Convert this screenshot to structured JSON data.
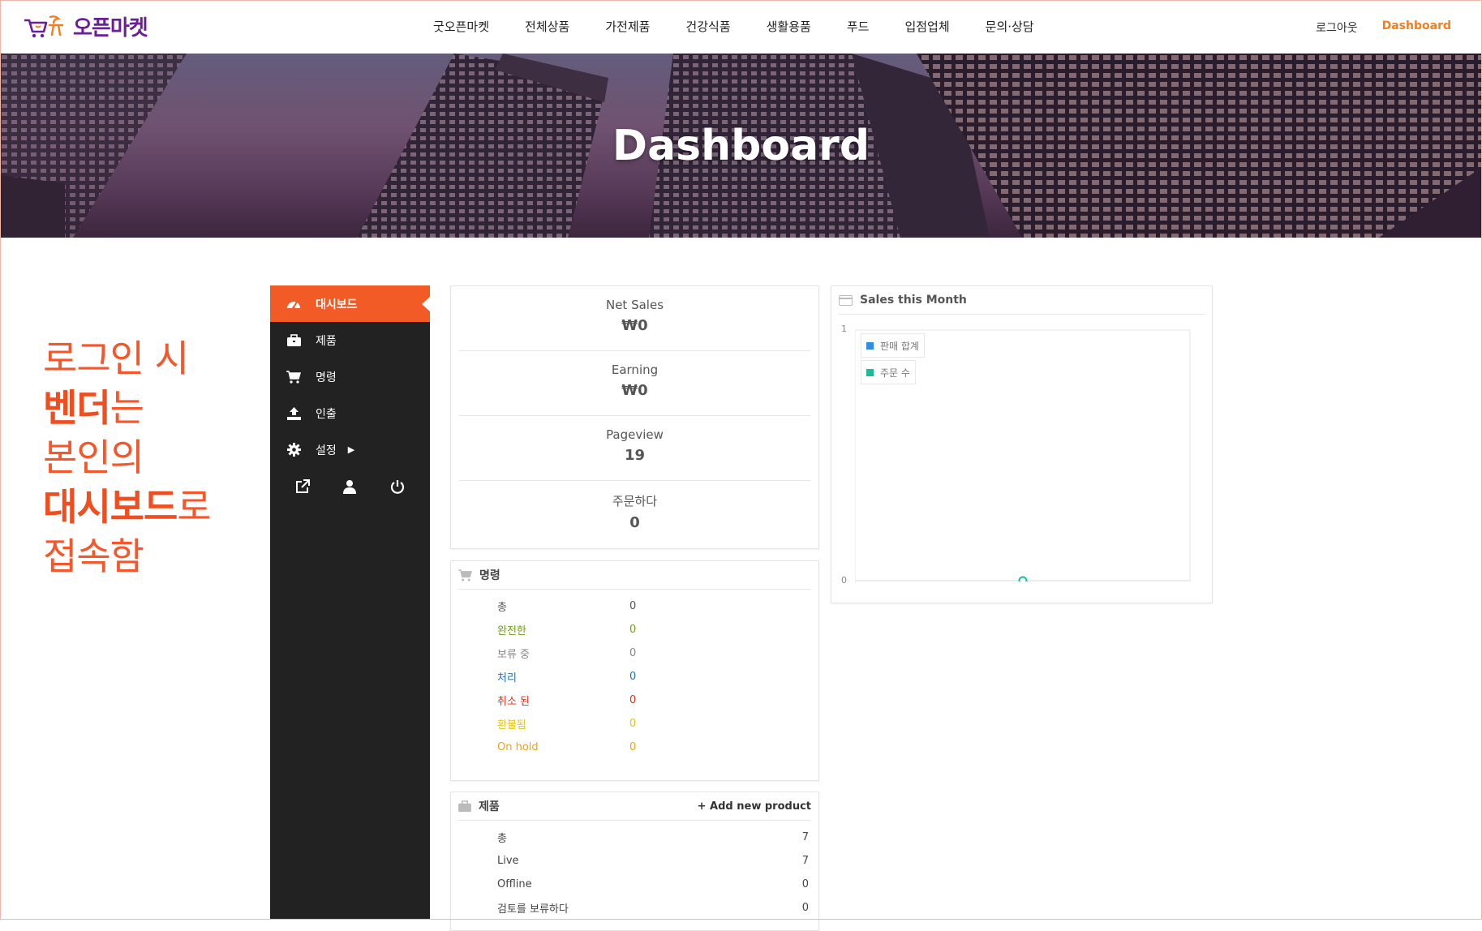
{
  "brand": {
    "name": "오픈마켓",
    "accent": "#f25a26",
    "logo_color": "#6a1f9a"
  },
  "nav": {
    "items": [
      "굿오픈마켓",
      "전체상품",
      "가전제품",
      "건강식품",
      "생활용품",
      "푸드",
      "입점업체",
      "문의·상담"
    ],
    "logout": "로그아웃",
    "dashboard": "Dashboard"
  },
  "hero": {
    "title": "Dashboard"
  },
  "tagline": {
    "line1": "로그인 시",
    "line2_bold": "벤더",
    "line2_rest": "는",
    "line3": "본인의",
    "line4_bold": "대시보드",
    "line4_rest": "로",
    "line5": "접속함"
  },
  "sidebar": {
    "items": [
      {
        "label": "대시보드",
        "icon": "dashboard-gauge-icon",
        "active": true
      },
      {
        "label": "제품",
        "icon": "briefcase-icon"
      },
      {
        "label": "명령",
        "icon": "cart-icon"
      },
      {
        "label": "인출",
        "icon": "upload-icon"
      },
      {
        "label": "설정",
        "icon": "gear-icon"
      }
    ],
    "bottom_icons": [
      "external-link-icon",
      "user-icon",
      "power-icon"
    ]
  },
  "stats": [
    {
      "label": "Net Sales",
      "value": "₩0"
    },
    {
      "label": "Earning",
      "value": "₩0"
    },
    {
      "label": "Pageview",
      "value": "19"
    },
    {
      "label": "주문하다",
      "value": "0"
    }
  ],
  "orders": {
    "title": "명령",
    "rows": [
      {
        "label": "총",
        "value": "0",
        "color": "#555555"
      },
      {
        "label": "완전한",
        "value": "0",
        "color": "#6aa312"
      },
      {
        "label": "보류 중",
        "value": "0",
        "color": "#888888"
      },
      {
        "label": "처리",
        "value": "0",
        "color": "#1f72b8"
      },
      {
        "label": "취소 된",
        "value": "0",
        "color": "#d9341c"
      },
      {
        "label": "환불됨",
        "value": "0",
        "color": "#e6c21a"
      },
      {
        "label": "On hold",
        "value": "0",
        "color": "#f0a21a"
      }
    ]
  },
  "products": {
    "title": "제품",
    "add_link": "+ Add new product",
    "rows": [
      {
        "label": "총",
        "value": "7"
      },
      {
        "label": "Live",
        "value": "7"
      },
      {
        "label": "Offline",
        "value": "0"
      },
      {
        "label": "검토를 보류하다",
        "value": "0"
      }
    ]
  },
  "sales": {
    "title": "Sales this Month",
    "y_max_label": "1",
    "y_min_label": "0",
    "legend": [
      {
        "name": "판매 합계",
        "color": "#2f8de4"
      },
      {
        "name": "주문 수",
        "color": "#1abc9c"
      }
    ]
  },
  "chart_data": {
    "type": "line",
    "title": "Sales this Month",
    "ylim": [
      0,
      1
    ],
    "series": [
      {
        "name": "판매 합계",
        "values": []
      },
      {
        "name": "주문 수",
        "values": [
          0
        ]
      }
    ]
  }
}
